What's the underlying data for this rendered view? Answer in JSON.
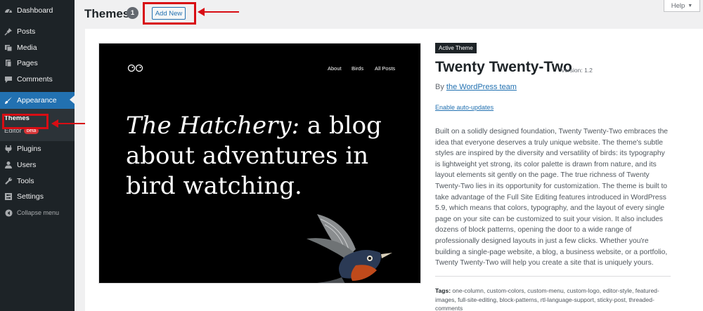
{
  "sidebar": {
    "items": [
      {
        "label": "Dashboard",
        "icon": "dashboard-icon"
      },
      {
        "label": "Posts",
        "icon": "pin-icon"
      },
      {
        "label": "Media",
        "icon": "media-icon"
      },
      {
        "label": "Pages",
        "icon": "page-icon"
      },
      {
        "label": "Comments",
        "icon": "comment-icon"
      },
      {
        "label": "Appearance",
        "icon": "brush-icon"
      },
      {
        "label": "Plugins",
        "icon": "plugin-icon"
      },
      {
        "label": "Users",
        "icon": "user-icon"
      },
      {
        "label": "Tools",
        "icon": "wrench-icon"
      },
      {
        "label": "Settings",
        "icon": "settings-icon"
      }
    ],
    "submenu": {
      "themes_label": "Themes",
      "editor_label": "Editor",
      "beta_badge": "beta"
    },
    "collapse_label": "Collapse menu"
  },
  "header": {
    "title": "Themes",
    "count": "1",
    "add_new_label": "Add New",
    "help_label": "Help"
  },
  "theme": {
    "active_badge": "Active Theme",
    "name": "Twenty Twenty-Two",
    "version": "Version: 1.2",
    "author_prefix": "By",
    "author_name": "the WordPress team",
    "auto_updates_label": "Enable auto-updates",
    "description": "Built on a solidly designed foundation, Twenty Twenty-Two embraces the idea that everyone deserves a truly unique website. The theme's subtle styles are inspired by the diversity and versatility of birds: its typography is lightweight yet strong, its color palette is drawn from nature, and its layout elements sit gently on the page. The true richness of Twenty Twenty-Two lies in its opportunity for customization. The theme is built to take advantage of the Full Site Editing features introduced in WordPress 5.9, which means that colors, typography, and the layout of every single page on your site can be customized to suit your vision. It also includes dozens of block patterns, opening the door to a wide range of professionally designed layouts in just a few clicks. Whether you're building a single-page website, a blog, a business website, or a portfolio, Twenty Twenty-Two will help you create a site that is uniquely yours.",
    "tags_label": "Tags:",
    "tags": "one-column, custom-colors, custom-menu, custom-logo, editor-style, featured-images, full-site-editing, block-patterns, rtl-language-support, sticky-post, threaded-comments"
  },
  "preview": {
    "nav": [
      "About",
      "Birds",
      "All Posts"
    ],
    "headline_italic": "The Hatchery:",
    "headline_rest": " a blog about adventures in bird watching."
  },
  "colors": {
    "sidebar_bg": "#1d2327",
    "accent": "#2271b1",
    "annotation_red": "#d80d14"
  }
}
